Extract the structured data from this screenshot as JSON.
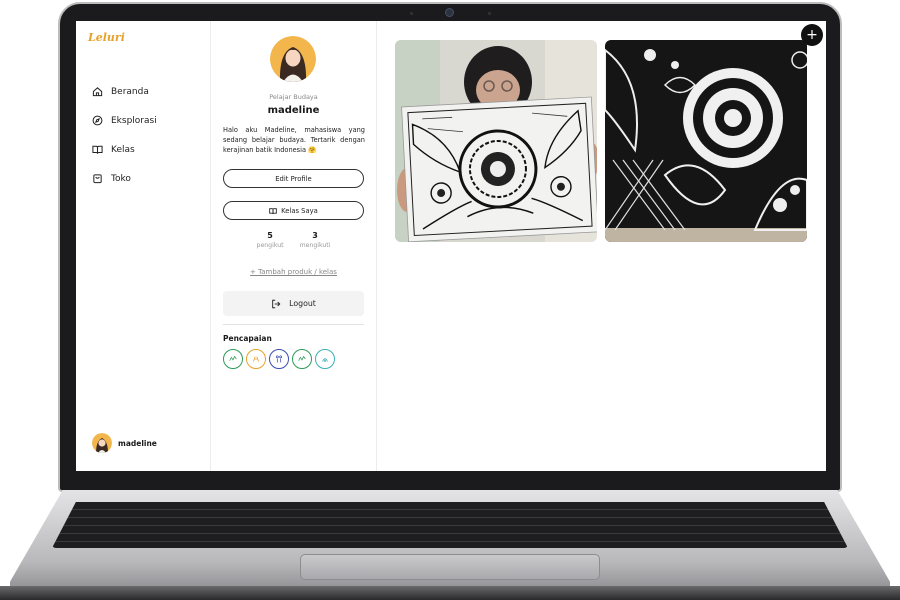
{
  "app": {
    "logo": "Leluri"
  },
  "sidebar": {
    "items": [
      {
        "label": "Beranda",
        "icon": "home-icon"
      },
      {
        "label": "Eksplorasi",
        "icon": "compass-icon"
      },
      {
        "label": "Kelas",
        "icon": "book-icon"
      },
      {
        "label": "Toko",
        "icon": "shopping-bag-icon"
      }
    ],
    "user_name": "madeline"
  },
  "profile": {
    "role": "Pelajar Budaya",
    "name": "madeline",
    "bio": "Halo aku Madeline, mahasiswa yang sedang belajar budaya. Tertarik dengan kerajinan batik Indonesia 🤗",
    "edit_label": "Edit Profile",
    "kelas_label": "Kelas Saya",
    "followers_count": "5",
    "followers_label": "pengikut",
    "following_count": "3",
    "following_label": "mengikuti",
    "add_link": "+ Tambah produk / kelas",
    "logout_label": "Logout",
    "achievements_title": "Pencapaian",
    "badge_colors": [
      "#2e9b5a",
      "#e8a22c",
      "#3a4fb0",
      "#2e9b5a",
      "#3bb0b8"
    ],
    "badge_icons": [
      "achievement-badge-icon",
      "achievement-badge-icon",
      "achievement-badge-icon",
      "achievement-badge-icon",
      "achievement-badge-icon"
    ]
  },
  "gallery": {
    "add_icon": "plus-icon",
    "photos": [
      "batik-drawing-photo",
      "batik-pattern-photo"
    ]
  },
  "colors": {
    "accent": "#e8a22c",
    "text": "#1a1a1a",
    "muted": "#888888"
  }
}
